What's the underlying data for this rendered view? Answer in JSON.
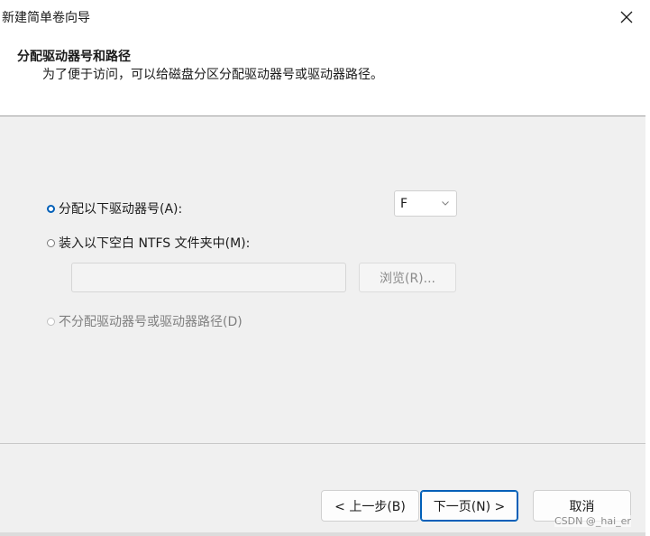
{
  "window": {
    "title": "新建简单卷向导"
  },
  "header": {
    "title": "分配驱动器号和路径",
    "subtitle": "为了便于访问，可以给磁盘分区分配驱动器号或驱动器路径。"
  },
  "options": {
    "assign_letter": {
      "label": "分配以下驱动器号(A):",
      "checked": true,
      "enabled": true
    },
    "mount_folder": {
      "label": "装入以下空白 NTFS 文件夹中(M):",
      "checked": false,
      "enabled": true
    },
    "no_assign": {
      "label": "不分配驱动器号或驱动器路径(D)",
      "checked": false,
      "enabled": false
    }
  },
  "drive_select": {
    "selected": "F"
  },
  "folder_path": {
    "value": "",
    "enabled": false
  },
  "browse_button": {
    "label": "浏览(R)...",
    "enabled": false
  },
  "footer": {
    "back_label": "< 上一步(B)",
    "next_label": "下一页(N) >",
    "cancel_label": "取消"
  },
  "watermark": "CSDN @_hai_er",
  "colors": {
    "accent": "#005fb8",
    "background": "#f0f0f0",
    "header_bg": "#ffffff",
    "disabled_text": "#7f7f7f"
  },
  "icons": {
    "close": "close-icon",
    "dropdown": "chevron-down-icon"
  }
}
